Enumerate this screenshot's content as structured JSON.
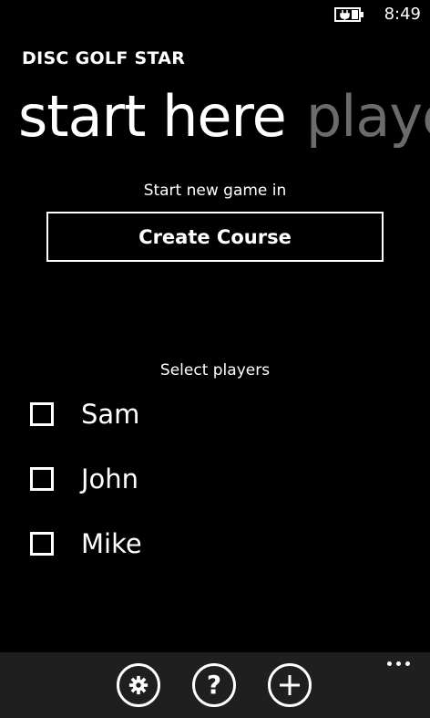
{
  "status_bar": {
    "time": "8:49"
  },
  "app": {
    "title": "DISC GOLF STAR"
  },
  "pivot": {
    "active_label": "start here",
    "next_label": "players"
  },
  "new_game": {
    "caption": "Start new game in",
    "button_label": "Create Course"
  },
  "players": {
    "caption": "Select players",
    "list": [
      {
        "name": "Sam",
        "checked": false
      },
      {
        "name": "John",
        "checked": false
      },
      {
        "name": "Mike",
        "checked": false
      }
    ]
  },
  "app_bar": {
    "icons": [
      "gear-icon",
      "help-icon",
      "add-icon"
    ],
    "help_glyph": "?",
    "more_icon": "ellipsis-icon"
  },
  "colors": {
    "background": "#000000",
    "foreground": "#ffffff",
    "inactive_pivot": "#6b6b6b",
    "app_bar": "#1f1f1f"
  }
}
